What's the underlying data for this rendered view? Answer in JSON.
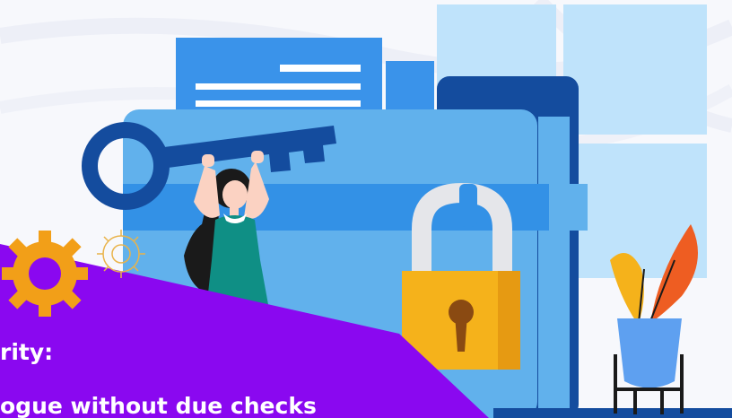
{
  "caption": {
    "line1": "rity:",
    "line2": "ogue without due checks"
  },
  "colors": {
    "banner": "#8a08f0",
    "light_blue": "#bfe3fb",
    "mid_blue": "#61b1ec",
    "blue": "#3391e6",
    "dark_blue": "#144c9e",
    "lock_gold": "#f5b21b",
    "gear_orange": "#f29f18",
    "leaf_orange": "#ee5d22",
    "dress_green": "#0f8f85"
  },
  "icons": [
    "key-icon",
    "padlock-icon",
    "gear-icon",
    "gear-outline-icon",
    "plant-icon",
    "woman-illustration"
  ]
}
